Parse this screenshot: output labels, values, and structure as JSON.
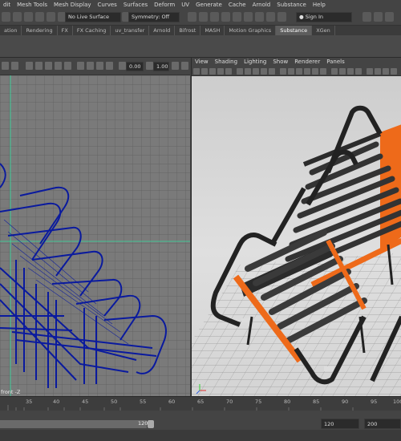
{
  "menubar": {
    "items": [
      "dit",
      "Mesh Tools",
      "Mesh Display",
      "Curves",
      "Surfaces",
      "Deform",
      "UV",
      "Generate",
      "Cache",
      "Arnold",
      "Substance",
      "Help"
    ]
  },
  "statusline": {
    "live_surface": "No Live Surface",
    "symmetry": "Symmetry: Off",
    "sign_in": "Sign In"
  },
  "shelf": {
    "tabs": [
      "ation",
      "Rendering",
      "FX",
      "FX Caching",
      "uv_transfer",
      "Arnold",
      "Bifrost",
      "MASH",
      "Motion Graphics",
      "Substance",
      "XGen"
    ],
    "active_tab": "Substance"
  },
  "left_view": {
    "exposure": "0.00",
    "gamma": "1.00",
    "label": "front -Z"
  },
  "right_view": {
    "menu": [
      "View",
      "Shading",
      "Lighting",
      "Show",
      "Renderer",
      "Panels"
    ]
  },
  "timeline": {
    "ticks": [
      "35",
      "40",
      "45",
      "50",
      "55",
      "60",
      "65",
      "70",
      "75",
      "80",
      "85",
      "90",
      "95",
      "100"
    ]
  },
  "range": {
    "end": "120",
    "anim_end": "120",
    "anim_total": "200"
  },
  "colors": {
    "grid_bg": "#7a7a7a",
    "wire": "#0a1a9e",
    "axis": "#2fe0a0",
    "stair_orange": "#ee6a1a",
    "stair_dark": "#2b2b2b"
  }
}
